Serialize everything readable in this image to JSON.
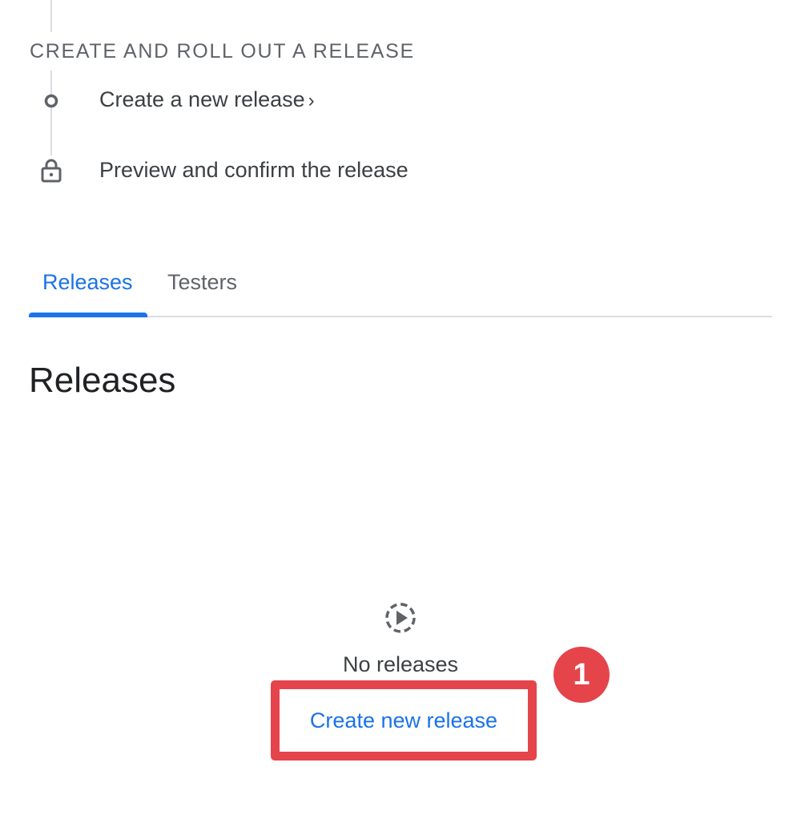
{
  "stepper": {
    "section_heading": "CREATE AND ROLL OUT A RELEASE",
    "steps": [
      {
        "label": "Create a new release",
        "chevron": "›",
        "icon": "circle-icon"
      },
      {
        "label": "Preview and confirm the release",
        "icon": "lock-icon"
      }
    ]
  },
  "tabs": [
    {
      "label": "Releases",
      "active": true
    },
    {
      "label": "Testers",
      "active": false
    }
  ],
  "page_title": "Releases",
  "empty_state": {
    "icon": "play-circle-dashed-icon",
    "text": "No releases",
    "button_label": "Create new release"
  },
  "annotation": {
    "badge_number": "1",
    "color": "#e5444b"
  },
  "colors": {
    "accent": "#1a73e8",
    "heading_gray": "#5f6368",
    "text": "#202124",
    "divider": "#dadce0"
  }
}
